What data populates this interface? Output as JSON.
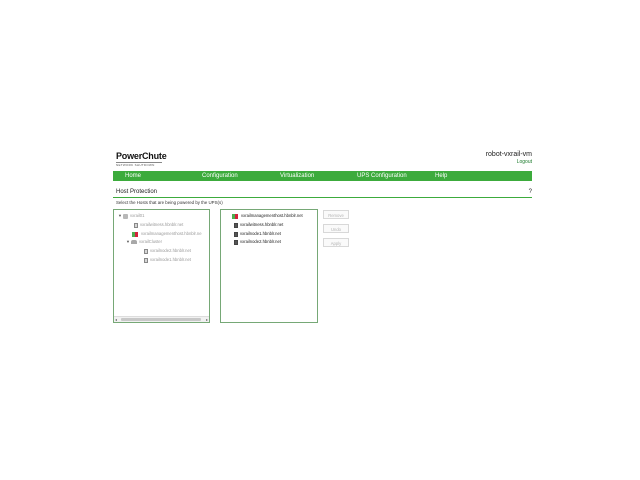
{
  "header": {
    "logo_text": "PowerChute",
    "logo_sub": "NETWORK SHUTDOWN",
    "host_name": "robot-vxrail-vm",
    "logout_label": "Logout"
  },
  "nav": {
    "items": [
      {
        "label": "Home"
      },
      {
        "label": "Configuration"
      },
      {
        "label": "Virtualization"
      },
      {
        "label": "UPS Configuration"
      },
      {
        "label": "Help"
      }
    ]
  },
  "section": {
    "title": "Host Protection",
    "help_label": "?",
    "instructions": "Select the Hosts that are being powered by the UPS(s)"
  },
  "available_tree": [
    {
      "label": "vxrail01",
      "type": "datacenter",
      "expander": "▼"
    },
    {
      "label": "vxrailwitness.hbnblr.net",
      "type": "vm"
    },
    {
      "label": "vxrailmanagementhost.hbnblr.ne",
      "type": "mgmt"
    },
    {
      "label": "vxrailCluster",
      "type": "cluster",
      "expander": "▼"
    },
    {
      "label": "vxrailnode2.hbnblr.net",
      "type": "vm"
    },
    {
      "label": "vxrailnode1.hbnblr.net",
      "type": "vm"
    }
  ],
  "selected_list": [
    {
      "label": "vxrailmanagementhost.hbnblr.net",
      "type": "mgmt"
    },
    {
      "label": "vxrailwitness.hbnblr.net",
      "type": "vm"
    },
    {
      "label": "vxrailnode1.hbnblr.net",
      "type": "vm"
    },
    {
      "label": "vxrailnode2.hbnblr.net",
      "type": "vm"
    }
  ],
  "scrollbar": {
    "left_arrow": "◂",
    "right_arrow": "▸"
  },
  "buttons": {
    "remove_label": "Remove",
    "undo_label": "Undo",
    "apply_label": "Apply"
  },
  "colors": {
    "nav_green": "#3cab3c",
    "link_green": "#1a7a2b",
    "mgmt_icon_green": "#4caf50",
    "mgmt_icon_red": "#d2233c"
  }
}
